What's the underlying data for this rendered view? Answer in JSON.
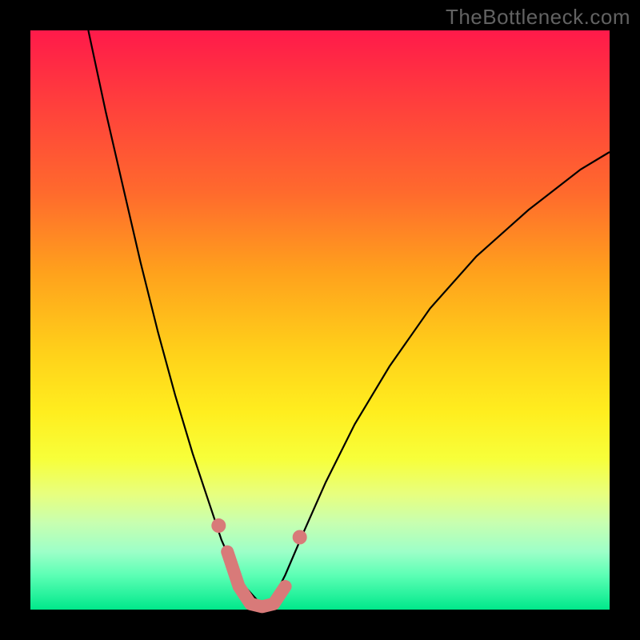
{
  "attribution": "TheBottleneck.com",
  "chart_data": {
    "type": "line",
    "title": "",
    "xlabel": "",
    "ylabel": "",
    "ylim": [
      0,
      100
    ],
    "xlim": [
      0,
      100
    ],
    "series": [
      {
        "name": "left-branch",
        "x": [
          10,
          13,
          16,
          19,
          22,
          25,
          28,
          31,
          33,
          35,
          37,
          39,
          40.5
        ],
        "values": [
          100,
          86,
          73,
          60,
          48,
          37,
          27,
          18,
          12,
          7.5,
          4,
          1.8,
          0
        ]
      },
      {
        "name": "right-branch",
        "x": [
          40.5,
          42,
          44,
          47,
          51,
          56,
          62,
          69,
          77,
          86,
          95,
          100
        ],
        "values": [
          0,
          2,
          6,
          13,
          22,
          32,
          42,
          52,
          61,
          69,
          76,
          79
        ]
      }
    ],
    "markers": {
      "trough_path_x": [
        34,
        36,
        38,
        40,
        42,
        44
      ],
      "trough_path_y": [
        10,
        4,
        1,
        0.5,
        1,
        4
      ],
      "left_outlier": {
        "x": 32.5,
        "y": 14.5
      },
      "right_outlier": {
        "x": 46.5,
        "y": 12.5
      }
    },
    "colors": {
      "curve": "#000000",
      "markers": "#d87a79",
      "gradient_top": "#ff1a4a",
      "gradient_bottom": "#00e88b"
    }
  }
}
